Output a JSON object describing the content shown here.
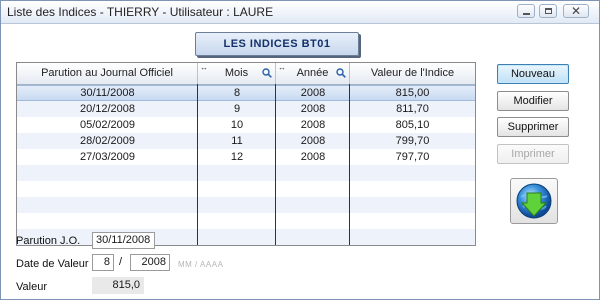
{
  "window": {
    "title": "Liste des Indices - THIERRY - Utilisateur : LAURE"
  },
  "window_controls": {
    "close_glyph": "✕"
  },
  "banner": {
    "label": "LES  INDICES BT01"
  },
  "table": {
    "columns": [
      "Parution au Journal Officiel",
      "Mois",
      "Année",
      "Valeur de l'Indice"
    ],
    "rows": [
      [
        "30/11/2008",
        "8",
        "2008",
        "815,00"
      ],
      [
        "20/12/2008",
        "9",
        "2008",
        "811,70"
      ],
      [
        "05/02/2009",
        "10",
        "2008",
        "805,10"
      ],
      [
        "28/02/2009",
        "11",
        "2008",
        "799,70"
      ],
      [
        "27/03/2009",
        "12",
        "2008",
        "797,70"
      ]
    ],
    "selected_row": 0
  },
  "buttons": {
    "new": "Nouveau",
    "edit": "Modifier",
    "delete": "Supprimer",
    "print": "Imprimer"
  },
  "form": {
    "parution_label": "Parution J.O.",
    "parution_value": "30/11/2008",
    "date_label": "Date de Valeur",
    "month_value": "8",
    "separator": "/",
    "year_value": "2008",
    "date_hint": "MM / AAAA",
    "valeur_label": "Valeur",
    "valeur_value": "815,0"
  },
  "icons": {
    "search": "magnifier-icon",
    "globe": "globe-download-icon"
  },
  "colors": {
    "selected_row": "#c8daf1",
    "stripe": "#eef3fb",
    "banner_text": "#12306a",
    "primary_border": "#3c7fb1"
  }
}
